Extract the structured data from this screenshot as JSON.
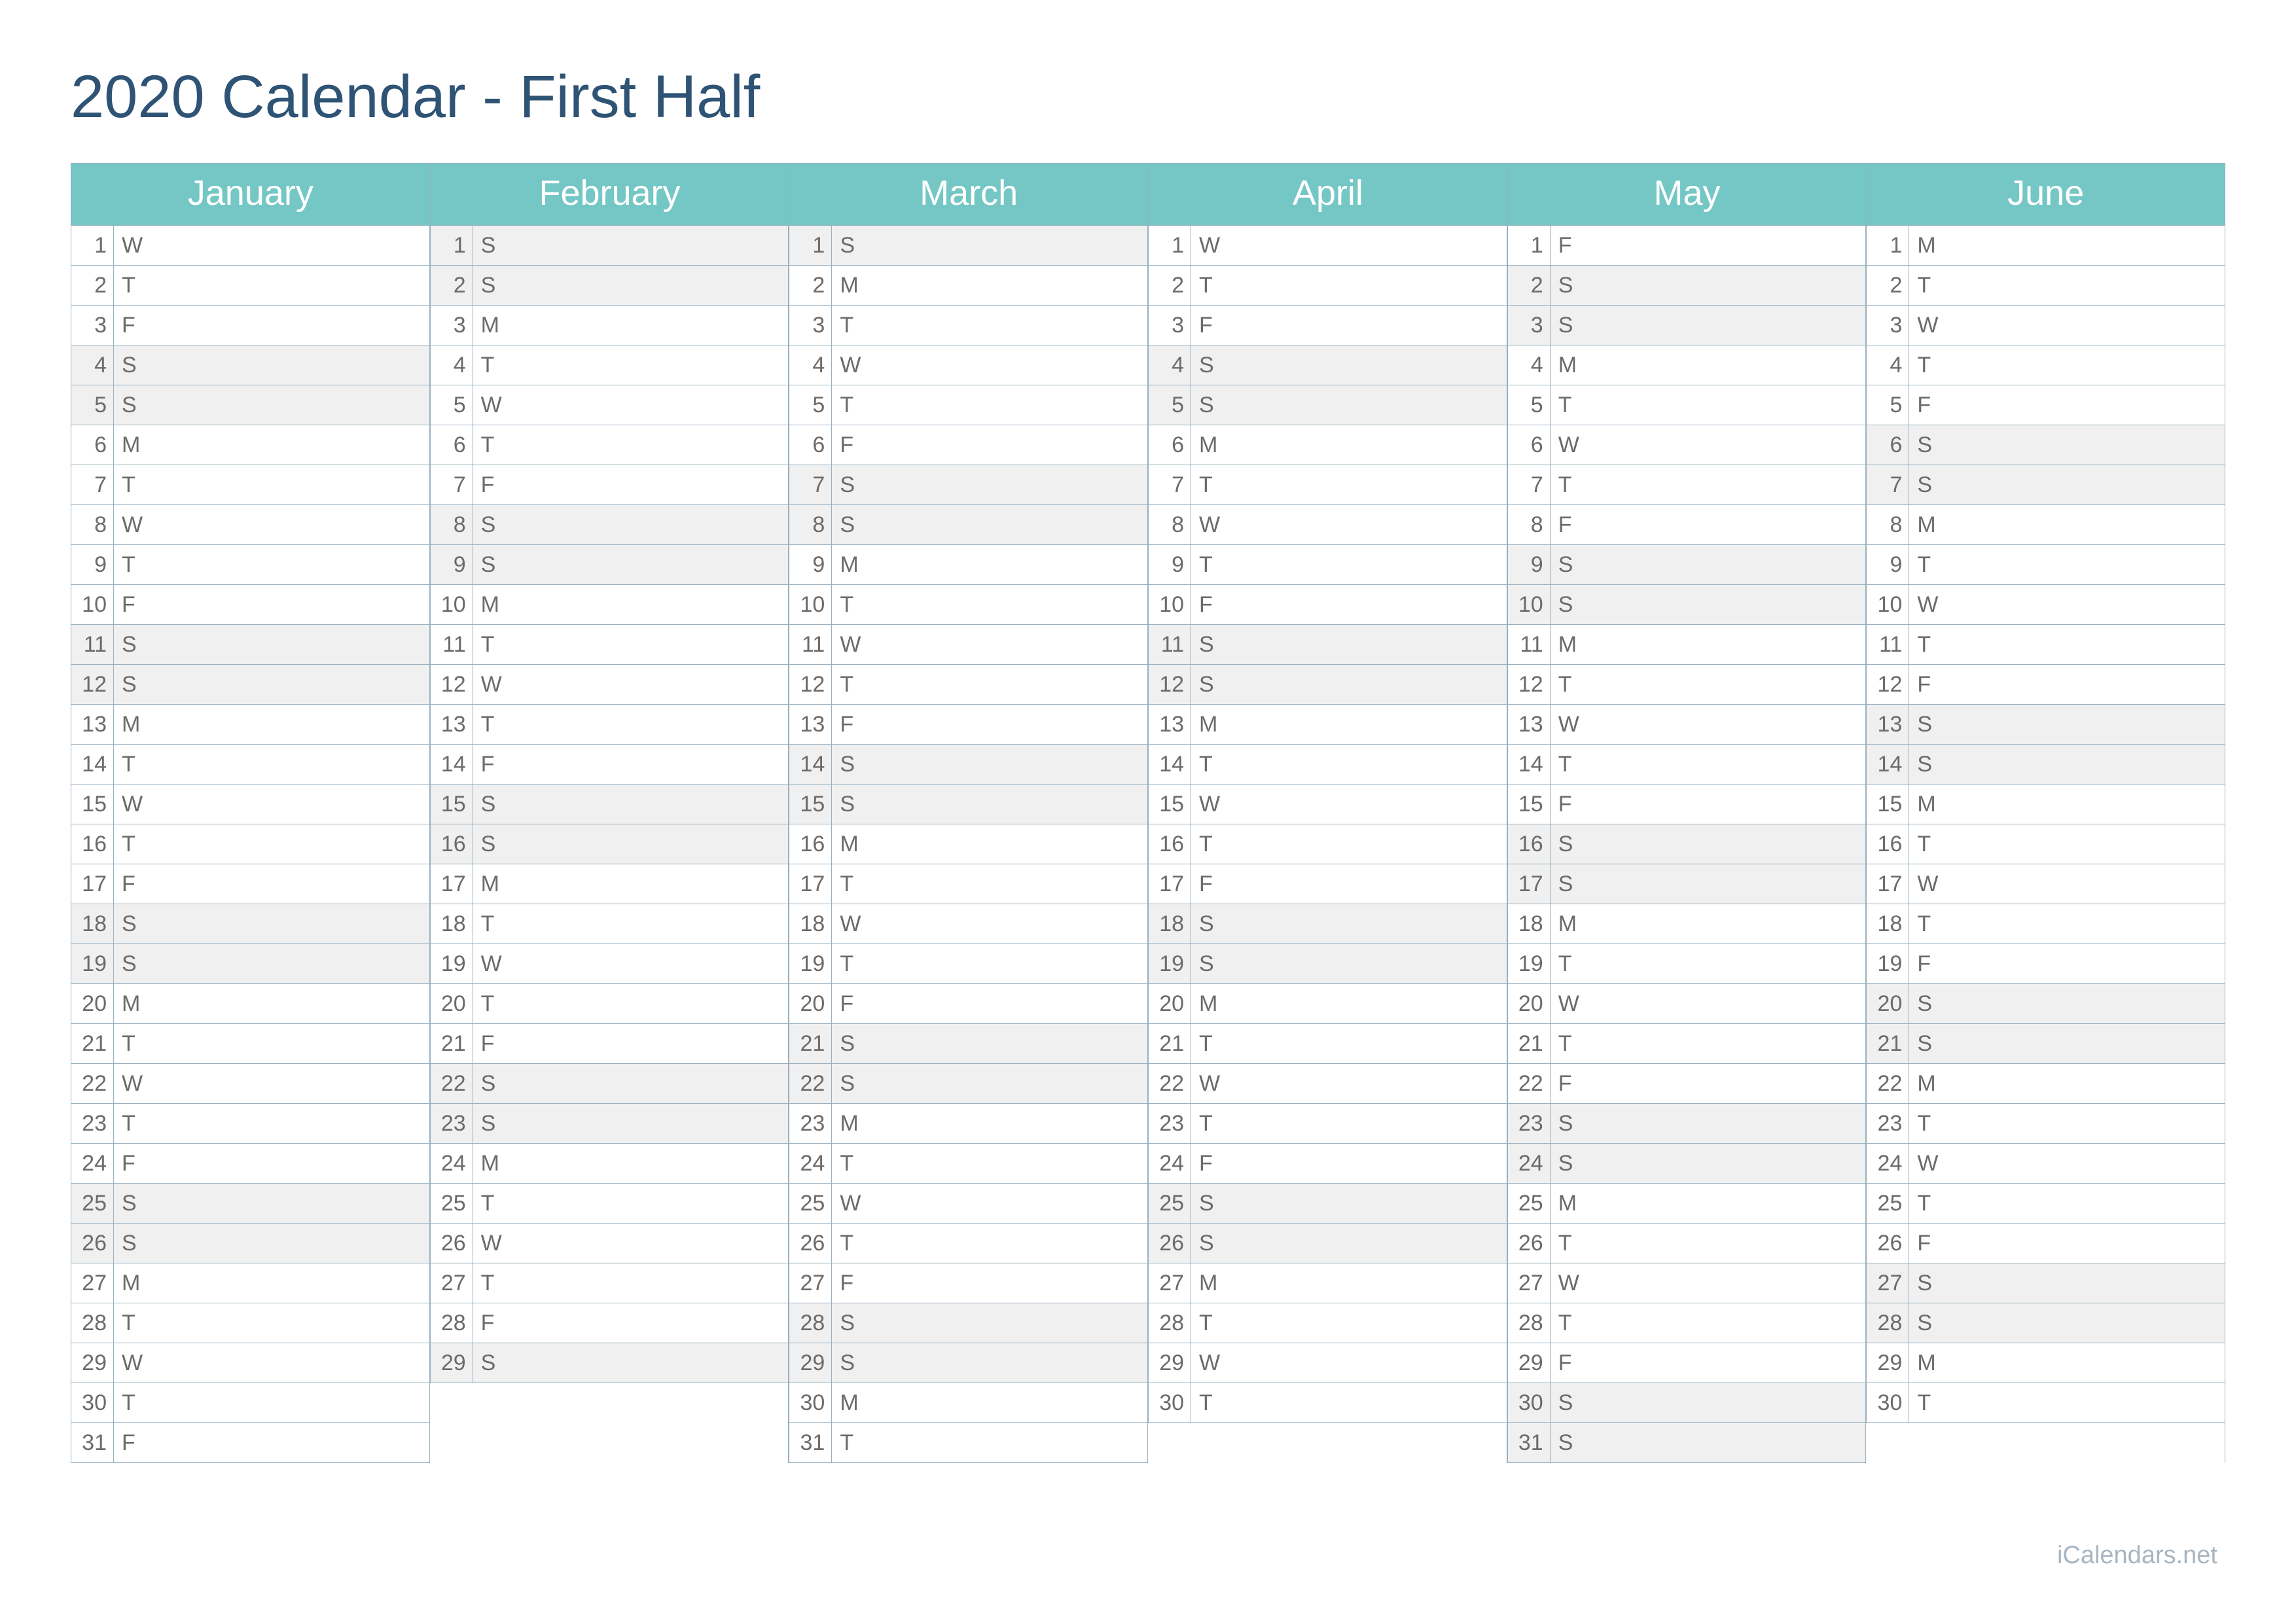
{
  "title": "2020 Calendar - First Half",
  "footer": "iCalendars.net",
  "colors": {
    "accent": "#74c7c5",
    "title": "#2f5374",
    "weekend_bg": "#f0f0f0",
    "grid": "#98b0c0"
  },
  "rows": 31,
  "months": [
    {
      "name": "January",
      "days": [
        {
          "n": "1",
          "d": "W",
          "w": false
        },
        {
          "n": "2",
          "d": "T",
          "w": false
        },
        {
          "n": "3",
          "d": "F",
          "w": false
        },
        {
          "n": "4",
          "d": "S",
          "w": true
        },
        {
          "n": "5",
          "d": "S",
          "w": true
        },
        {
          "n": "6",
          "d": "M",
          "w": false
        },
        {
          "n": "7",
          "d": "T",
          "w": false
        },
        {
          "n": "8",
          "d": "W",
          "w": false
        },
        {
          "n": "9",
          "d": "T",
          "w": false
        },
        {
          "n": "10",
          "d": "F",
          "w": false
        },
        {
          "n": "11",
          "d": "S",
          "w": true
        },
        {
          "n": "12",
          "d": "S",
          "w": true
        },
        {
          "n": "13",
          "d": "M",
          "w": false
        },
        {
          "n": "14",
          "d": "T",
          "w": false
        },
        {
          "n": "15",
          "d": "W",
          "w": false
        },
        {
          "n": "16",
          "d": "T",
          "w": false
        },
        {
          "n": "17",
          "d": "F",
          "w": false
        },
        {
          "n": "18",
          "d": "S",
          "w": true
        },
        {
          "n": "19",
          "d": "S",
          "w": true
        },
        {
          "n": "20",
          "d": "M",
          "w": false
        },
        {
          "n": "21",
          "d": "T",
          "w": false
        },
        {
          "n": "22",
          "d": "W",
          "w": false
        },
        {
          "n": "23",
          "d": "T",
          "w": false
        },
        {
          "n": "24",
          "d": "F",
          "w": false
        },
        {
          "n": "25",
          "d": "S",
          "w": true
        },
        {
          "n": "26",
          "d": "S",
          "w": true
        },
        {
          "n": "27",
          "d": "M",
          "w": false
        },
        {
          "n": "28",
          "d": "T",
          "w": false
        },
        {
          "n": "29",
          "d": "W",
          "w": false
        },
        {
          "n": "30",
          "d": "T",
          "w": false
        },
        {
          "n": "31",
          "d": "F",
          "w": false
        }
      ]
    },
    {
      "name": "February",
      "days": [
        {
          "n": "1",
          "d": "S",
          "w": true
        },
        {
          "n": "2",
          "d": "S",
          "w": true
        },
        {
          "n": "3",
          "d": "M",
          "w": false
        },
        {
          "n": "4",
          "d": "T",
          "w": false
        },
        {
          "n": "5",
          "d": "W",
          "w": false
        },
        {
          "n": "6",
          "d": "T",
          "w": false
        },
        {
          "n": "7",
          "d": "F",
          "w": false
        },
        {
          "n": "8",
          "d": "S",
          "w": true
        },
        {
          "n": "9",
          "d": "S",
          "w": true
        },
        {
          "n": "10",
          "d": "M",
          "w": false
        },
        {
          "n": "11",
          "d": "T",
          "w": false
        },
        {
          "n": "12",
          "d": "W",
          "w": false
        },
        {
          "n": "13",
          "d": "T",
          "w": false
        },
        {
          "n": "14",
          "d": "F",
          "w": false
        },
        {
          "n": "15",
          "d": "S",
          "w": true
        },
        {
          "n": "16",
          "d": "S",
          "w": true
        },
        {
          "n": "17",
          "d": "M",
          "w": false
        },
        {
          "n": "18",
          "d": "T",
          "w": false
        },
        {
          "n": "19",
          "d": "W",
          "w": false
        },
        {
          "n": "20",
          "d": "T",
          "w": false
        },
        {
          "n": "21",
          "d": "F",
          "w": false
        },
        {
          "n": "22",
          "d": "S",
          "w": true
        },
        {
          "n": "23",
          "d": "S",
          "w": true
        },
        {
          "n": "24",
          "d": "M",
          "w": false
        },
        {
          "n": "25",
          "d": "T",
          "w": false
        },
        {
          "n": "26",
          "d": "W",
          "w": false
        },
        {
          "n": "27",
          "d": "T",
          "w": false
        },
        {
          "n": "28",
          "d": "F",
          "w": false
        },
        {
          "n": "29",
          "d": "S",
          "w": true
        }
      ]
    },
    {
      "name": "March",
      "days": [
        {
          "n": "1",
          "d": "S",
          "w": true
        },
        {
          "n": "2",
          "d": "M",
          "w": false
        },
        {
          "n": "3",
          "d": "T",
          "w": false
        },
        {
          "n": "4",
          "d": "W",
          "w": false
        },
        {
          "n": "5",
          "d": "T",
          "w": false
        },
        {
          "n": "6",
          "d": "F",
          "w": false
        },
        {
          "n": "7",
          "d": "S",
          "w": true
        },
        {
          "n": "8",
          "d": "S",
          "w": true
        },
        {
          "n": "9",
          "d": "M",
          "w": false
        },
        {
          "n": "10",
          "d": "T",
          "w": false
        },
        {
          "n": "11",
          "d": "W",
          "w": false
        },
        {
          "n": "12",
          "d": "T",
          "w": false
        },
        {
          "n": "13",
          "d": "F",
          "w": false
        },
        {
          "n": "14",
          "d": "S",
          "w": true
        },
        {
          "n": "15",
          "d": "S",
          "w": true
        },
        {
          "n": "16",
          "d": "M",
          "w": false
        },
        {
          "n": "17",
          "d": "T",
          "w": false
        },
        {
          "n": "18",
          "d": "W",
          "w": false
        },
        {
          "n": "19",
          "d": "T",
          "w": false
        },
        {
          "n": "20",
          "d": "F",
          "w": false
        },
        {
          "n": "21",
          "d": "S",
          "w": true
        },
        {
          "n": "22",
          "d": "S",
          "w": true
        },
        {
          "n": "23",
          "d": "M",
          "w": false
        },
        {
          "n": "24",
          "d": "T",
          "w": false
        },
        {
          "n": "25",
          "d": "W",
          "w": false
        },
        {
          "n": "26",
          "d": "T",
          "w": false
        },
        {
          "n": "27",
          "d": "F",
          "w": false
        },
        {
          "n": "28",
          "d": "S",
          "w": true
        },
        {
          "n": "29",
          "d": "S",
          "w": true
        },
        {
          "n": "30",
          "d": "M",
          "w": false
        },
        {
          "n": "31",
          "d": "T",
          "w": false
        }
      ]
    },
    {
      "name": "April",
      "days": [
        {
          "n": "1",
          "d": "W",
          "w": false
        },
        {
          "n": "2",
          "d": "T",
          "w": false
        },
        {
          "n": "3",
          "d": "F",
          "w": false
        },
        {
          "n": "4",
          "d": "S",
          "w": true
        },
        {
          "n": "5",
          "d": "S",
          "w": true
        },
        {
          "n": "6",
          "d": "M",
          "w": false
        },
        {
          "n": "7",
          "d": "T",
          "w": false
        },
        {
          "n": "8",
          "d": "W",
          "w": false
        },
        {
          "n": "9",
          "d": "T",
          "w": false
        },
        {
          "n": "10",
          "d": "F",
          "w": false
        },
        {
          "n": "11",
          "d": "S",
          "w": true
        },
        {
          "n": "12",
          "d": "S",
          "w": true
        },
        {
          "n": "13",
          "d": "M",
          "w": false
        },
        {
          "n": "14",
          "d": "T",
          "w": false
        },
        {
          "n": "15",
          "d": "W",
          "w": false
        },
        {
          "n": "16",
          "d": "T",
          "w": false
        },
        {
          "n": "17",
          "d": "F",
          "w": false
        },
        {
          "n": "18",
          "d": "S",
          "w": true
        },
        {
          "n": "19",
          "d": "S",
          "w": true
        },
        {
          "n": "20",
          "d": "M",
          "w": false
        },
        {
          "n": "21",
          "d": "T",
          "w": false
        },
        {
          "n": "22",
          "d": "W",
          "w": false
        },
        {
          "n": "23",
          "d": "T",
          "w": false
        },
        {
          "n": "24",
          "d": "F",
          "w": false
        },
        {
          "n": "25",
          "d": "S",
          "w": true
        },
        {
          "n": "26",
          "d": "S",
          "w": true
        },
        {
          "n": "27",
          "d": "M",
          "w": false
        },
        {
          "n": "28",
          "d": "T",
          "w": false
        },
        {
          "n": "29",
          "d": "W",
          "w": false
        },
        {
          "n": "30",
          "d": "T",
          "w": false
        }
      ]
    },
    {
      "name": "May",
      "days": [
        {
          "n": "1",
          "d": "F",
          "w": false
        },
        {
          "n": "2",
          "d": "S",
          "w": true
        },
        {
          "n": "3",
          "d": "S",
          "w": true
        },
        {
          "n": "4",
          "d": "M",
          "w": false
        },
        {
          "n": "5",
          "d": "T",
          "w": false
        },
        {
          "n": "6",
          "d": "W",
          "w": false
        },
        {
          "n": "7",
          "d": "T",
          "w": false
        },
        {
          "n": "8",
          "d": "F",
          "w": false
        },
        {
          "n": "9",
          "d": "S",
          "w": true
        },
        {
          "n": "10",
          "d": "S",
          "w": true
        },
        {
          "n": "11",
          "d": "M",
          "w": false
        },
        {
          "n": "12",
          "d": "T",
          "w": false
        },
        {
          "n": "13",
          "d": "W",
          "w": false
        },
        {
          "n": "14",
          "d": "T",
          "w": false
        },
        {
          "n": "15",
          "d": "F",
          "w": false
        },
        {
          "n": "16",
          "d": "S",
          "w": true
        },
        {
          "n": "17",
          "d": "S",
          "w": true
        },
        {
          "n": "18",
          "d": "M",
          "w": false
        },
        {
          "n": "19",
          "d": "T",
          "w": false
        },
        {
          "n": "20",
          "d": "W",
          "w": false
        },
        {
          "n": "21",
          "d": "T",
          "w": false
        },
        {
          "n": "22",
          "d": "F",
          "w": false
        },
        {
          "n": "23",
          "d": "S",
          "w": true
        },
        {
          "n": "24",
          "d": "S",
          "w": true
        },
        {
          "n": "25",
          "d": "M",
          "w": false
        },
        {
          "n": "26",
          "d": "T",
          "w": false
        },
        {
          "n": "27",
          "d": "W",
          "w": false
        },
        {
          "n": "28",
          "d": "T",
          "w": false
        },
        {
          "n": "29",
          "d": "F",
          "w": false
        },
        {
          "n": "30",
          "d": "S",
          "w": true
        },
        {
          "n": "31",
          "d": "S",
          "w": true
        }
      ]
    },
    {
      "name": "June",
      "days": [
        {
          "n": "1",
          "d": "M",
          "w": false
        },
        {
          "n": "2",
          "d": "T",
          "w": false
        },
        {
          "n": "3",
          "d": "W",
          "w": false
        },
        {
          "n": "4",
          "d": "T",
          "w": false
        },
        {
          "n": "5",
          "d": "F",
          "w": false
        },
        {
          "n": "6",
          "d": "S",
          "w": true
        },
        {
          "n": "7",
          "d": "S",
          "w": true
        },
        {
          "n": "8",
          "d": "M",
          "w": false
        },
        {
          "n": "9",
          "d": "T",
          "w": false
        },
        {
          "n": "10",
          "d": "W",
          "w": false
        },
        {
          "n": "11",
          "d": "T",
          "w": false
        },
        {
          "n": "12",
          "d": "F",
          "w": false
        },
        {
          "n": "13",
          "d": "S",
          "w": true
        },
        {
          "n": "14",
          "d": "S",
          "w": true
        },
        {
          "n": "15",
          "d": "M",
          "w": false
        },
        {
          "n": "16",
          "d": "T",
          "w": false
        },
        {
          "n": "17",
          "d": "W",
          "w": false
        },
        {
          "n": "18",
          "d": "T",
          "w": false
        },
        {
          "n": "19",
          "d": "F",
          "w": false
        },
        {
          "n": "20",
          "d": "S",
          "w": true
        },
        {
          "n": "21",
          "d": "S",
          "w": true
        },
        {
          "n": "22",
          "d": "M",
          "w": false
        },
        {
          "n": "23",
          "d": "T",
          "w": false
        },
        {
          "n": "24",
          "d": "W",
          "w": false
        },
        {
          "n": "25",
          "d": "T",
          "w": false
        },
        {
          "n": "26",
          "d": "F",
          "w": false
        },
        {
          "n": "27",
          "d": "S",
          "w": true
        },
        {
          "n": "28",
          "d": "S",
          "w": true
        },
        {
          "n": "29",
          "d": "M",
          "w": false
        },
        {
          "n": "30",
          "d": "T",
          "w": false
        }
      ]
    }
  ]
}
